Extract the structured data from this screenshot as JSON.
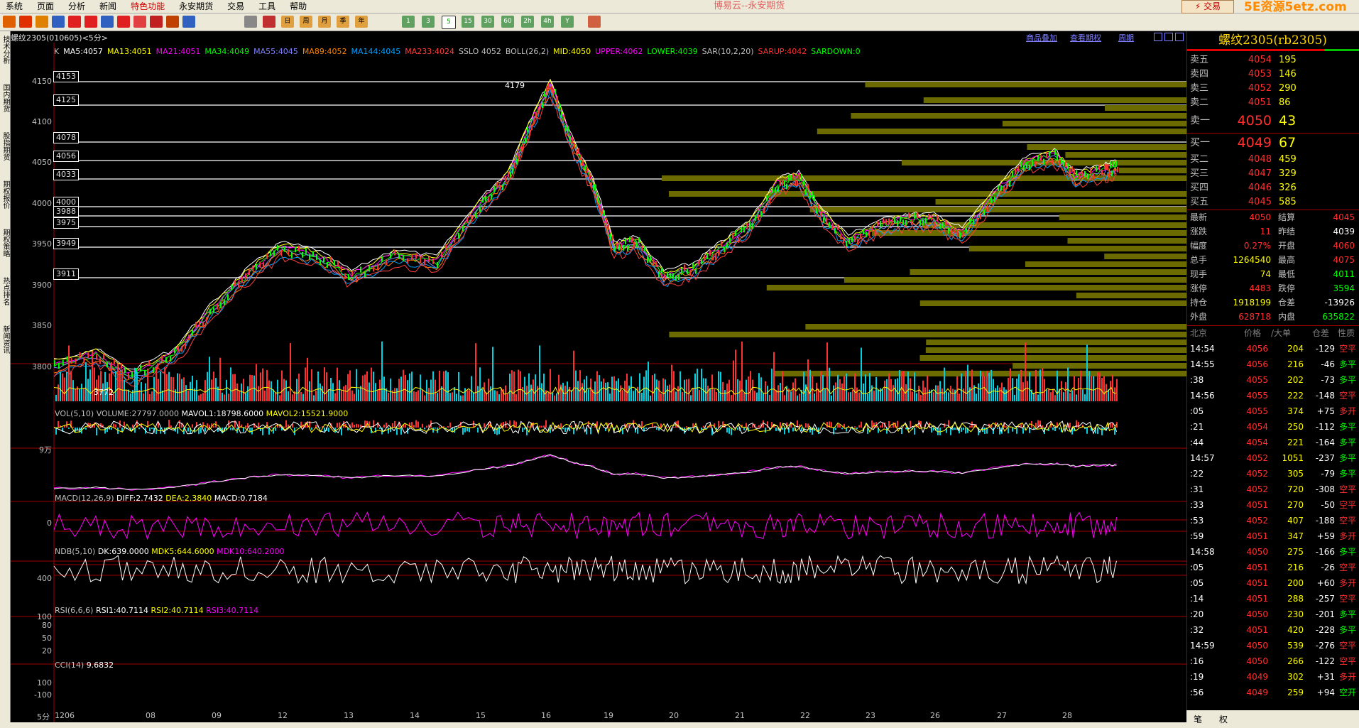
{
  "menu": {
    "items": [
      "系统",
      "页面",
      "分析",
      "新闻",
      "特色功能",
      "永安期货",
      "交易",
      "工具",
      "帮助"
    ],
    "highlight_index": 4
  },
  "app_title": "博易云--永安期货",
  "trade_button": "⚡ 交易",
  "watermark": "5E资源5etz.com",
  "toolbar": {
    "period_buttons": [
      "1",
      "3",
      "5",
      "15",
      "30",
      "60",
      "2h",
      "4h",
      "Y"
    ],
    "selected_period": "5",
    "other_buttons": [
      "日",
      "周",
      "月",
      "季",
      "年"
    ]
  },
  "left_tabs": [
    "技术分析",
    "国内期货",
    "股指期货",
    "期权报价",
    "期权策略",
    "热点排名",
    "新闻资讯"
  ],
  "chart_header": {
    "symbol": "螺纹2305(010605)<5分>",
    "links": [
      "商品叠加",
      "查看期权",
      "周期"
    ]
  },
  "indicator_line": [
    {
      "text": "K",
      "color": "#c0c0c0"
    },
    {
      "text": "MA5:4057",
      "color": "#ffffff"
    },
    {
      "text": "MA13:4051",
      "color": "#ffff00"
    },
    {
      "text": "MA21:4051",
      "color": "#ff00ff"
    },
    {
      "text": "MA34:4049",
      "color": "#00ff00"
    },
    {
      "text": "MA55:4045",
      "color": "#8080ff"
    },
    {
      "text": "MA89:4052",
      "color": "#ff8000"
    },
    {
      "text": "MA144:4045",
      "color": "#00a0ff"
    },
    {
      "text": "MA233:4024",
      "color": "#ff4040"
    },
    {
      "text": "SSLO 4052",
      "color": "#c0c0c0"
    },
    {
      "text": "BOLL(26,2)",
      "color": "#c0c0c0"
    },
    {
      "text": "MID:4050",
      "color": "#ffff00"
    },
    {
      "text": "UPPER:4062",
      "color": "#ff00ff"
    },
    {
      "text": "LOWER:4039",
      "color": "#00ff00"
    },
    {
      "text": "SAR(10,2,20)",
      "color": "#c0c0c0"
    },
    {
      "text": "SARUP:4042",
      "color": "#ff3030"
    },
    {
      "text": "SARDOWN:0",
      "color": "#00ff00"
    }
  ],
  "price_axis": [
    "4150",
    "4100",
    "4050",
    "4000",
    "3950",
    "3900",
    "3850",
    "3800"
  ],
  "level_boxes": [
    "4153",
    "4125",
    "4078",
    "4056",
    "4033",
    "4000",
    "3988",
    "3975",
    "3949",
    "3911"
  ],
  "annotations": {
    "high": "4179",
    "low": "3772"
  },
  "volume": {
    "label": "VOL(5,10) VOLUME:27797.0000",
    "mavol1": "MAVOL1:18798.6000",
    "mavol2": "MAVOL2:15521.9000",
    "axis": "9万"
  },
  "macd": {
    "label": "MACD(12,26,9)",
    "diff": "DIFF:2.7432",
    "dea": "DEA:2.3840",
    "macd": "MACD:0.7184",
    "axis": "0"
  },
  "ndb": {
    "label": "NDB(5,10)",
    "dk": "DK:639.0000",
    "mdk5": "MDK5:644.6000",
    "mdk10": "MDK10:640.2000",
    "axis": "400"
  },
  "rsi": {
    "label": "RSI(6,6,6)",
    "rsi1": "RSI1:40.7114",
    "rsi2": "RSI2:40.7114",
    "rsi3": "RSI3:40.7114",
    "axis": [
      "100",
      "80",
      "50",
      "20"
    ]
  },
  "cci": {
    "label": "CCI(14)",
    "value": "9.6832",
    "axis": [
      "100",
      "-100"
    ]
  },
  "x_axis": [
    "1206",
    "08",
    "09",
    "12",
    "13",
    "14",
    "15",
    "16",
    "19",
    "20",
    "21",
    "22",
    "23",
    "26",
    "27",
    "28"
  ],
  "x_period_label": "5分",
  "quote": {
    "title": "螺纹2305(rb2305)",
    "asks": [
      {
        "name": "卖五",
        "price": "4054",
        "vol": "195"
      },
      {
        "name": "卖四",
        "price": "4053",
        "vol": "146"
      },
      {
        "name": "卖三",
        "price": "4052",
        "vol": "290"
      },
      {
        "name": "卖二",
        "price": "4051",
        "vol": "86"
      },
      {
        "name": "卖一",
        "price": "4050",
        "vol": "43"
      }
    ],
    "bids": [
      {
        "name": "买一",
        "price": "4049",
        "vol": "67"
      },
      {
        "name": "买二",
        "price": "4048",
        "vol": "459"
      },
      {
        "name": "买三",
        "price": "4047",
        "vol": "329"
      },
      {
        "name": "买四",
        "price": "4046",
        "vol": "326"
      },
      {
        "name": "买五",
        "price": "4045",
        "vol": "585"
      }
    ],
    "stats": [
      {
        "l": "最新",
        "v": "4050",
        "vc": "#ff3030",
        "l2": "结算",
        "v2": "4045",
        "v2c": "#ff3030"
      },
      {
        "l": "涨跌",
        "v": "11",
        "vc": "#ff3030",
        "l2": "昨结",
        "v2": "4039",
        "v2c": "#ffffff"
      },
      {
        "l": "幅度",
        "v": "0.27%",
        "vc": "#ff3030",
        "l2": "开盘",
        "v2": "4060",
        "v2c": "#ff3030"
      },
      {
        "l": "总手",
        "v": "1264540",
        "vc": "#ffff00",
        "l2": "最高",
        "v2": "4075",
        "v2c": "#ff3030"
      },
      {
        "l": "现手",
        "v": "74",
        "vc": "#ffff00",
        "l2": "最低",
        "v2": "4011",
        "v2c": "#00ff00"
      },
      {
        "l": "涨停",
        "v": "4483",
        "vc": "#ff3030",
        "l2": "跌停",
        "v2": "3594",
        "v2c": "#00ff00"
      },
      {
        "l": "持仓",
        "v": "1918199",
        "vc": "#ffff00",
        "l2": "仓差",
        "v2": "-13926",
        "v2c": "#ffffff"
      },
      {
        "l": "外盘",
        "v": "628718",
        "vc": "#ff3030",
        "l2": "内盘",
        "v2": "635822",
        "v2c": "#00ff00"
      }
    ],
    "ticks_header": [
      "北京",
      "价格",
      "/大单",
      "仓差",
      "性质"
    ],
    "ticks": [
      {
        "t": "14:54",
        "p": "4056",
        "v": "204",
        "d": "-129",
        "k": "空平",
        "kc": "#ff3030"
      },
      {
        "t": "14:55",
        "p": "4056",
        "v": "216",
        "d": "-46",
        "k": "多平",
        "kc": "#00ff00"
      },
      {
        "t": ":38",
        "p": "4055",
        "v": "202",
        "d": "-73",
        "k": "多平",
        "kc": "#00ff00"
      },
      {
        "t": "14:56",
        "p": "4055",
        "v": "222",
        "d": "-148",
        "k": "空平",
        "kc": "#ff3030"
      },
      {
        "t": ":05",
        "p": "4055",
        "v": "374",
        "d": "+75",
        "k": "多开",
        "kc": "#ff3030"
      },
      {
        "t": ":21",
        "p": "4054",
        "v": "250",
        "d": "-112",
        "k": "多平",
        "kc": "#00ff00"
      },
      {
        "t": ":44",
        "p": "4054",
        "v": "221",
        "d": "-164",
        "k": "多平",
        "kc": "#00ff00"
      },
      {
        "t": "14:57",
        "p": "4052",
        "v": "1051",
        "d": "-237",
        "k": "多平",
        "kc": "#00ff00"
      },
      {
        "t": ":22",
        "p": "4052",
        "v": "305",
        "d": "-79",
        "k": "多平",
        "kc": "#00ff00"
      },
      {
        "t": ":31",
        "p": "4052",
        "v": "720",
        "d": "-308",
        "k": "空平",
        "kc": "#ff3030"
      },
      {
        "t": ":33",
        "p": "4051",
        "v": "270",
        "d": "-50",
        "k": "空平",
        "kc": "#ff3030"
      },
      {
        "t": ":53",
        "p": "4052",
        "v": "407",
        "d": "-188",
        "k": "空平",
        "kc": "#ff3030"
      },
      {
        "t": ":59",
        "p": "4051",
        "v": "347",
        "d": "+59",
        "k": "多开",
        "kc": "#ff3030"
      },
      {
        "t": "14:58",
        "p": "4050",
        "v": "275",
        "d": "-166",
        "k": "多平",
        "kc": "#00ff00"
      },
      {
        "t": ":05",
        "p": "4051",
        "v": "216",
        "d": "-26",
        "k": "空平",
        "kc": "#ff3030"
      },
      {
        "t": ":05",
        "p": "4051",
        "v": "200",
        "d": "+60",
        "k": "多开",
        "kc": "#ff3030"
      },
      {
        "t": ":14",
        "p": "4051",
        "v": "288",
        "d": "-257",
        "k": "空平",
        "kc": "#ff3030"
      },
      {
        "t": ":20",
        "p": "4050",
        "v": "230",
        "d": "-201",
        "k": "多平",
        "kc": "#00ff00"
      },
      {
        "t": ":32",
        "p": "4051",
        "v": "420",
        "d": "-228",
        "k": "多平",
        "kc": "#00ff00"
      },
      {
        "t": "14:59",
        "p": "4050",
        "v": "539",
        "d": "-276",
        "k": "空平",
        "kc": "#ff3030"
      },
      {
        "t": ":16",
        "p": "4050",
        "v": "266",
        "d": "-122",
        "k": "空平",
        "kc": "#ff3030"
      },
      {
        "t": ":19",
        "p": "4049",
        "v": "302",
        "d": "+31",
        "k": "多开",
        "kc": "#ff3030"
      },
      {
        "t": ":56",
        "p": "4049",
        "v": "259",
        "d": "+94",
        "k": "空开",
        "kc": "#00ff00"
      }
    ],
    "bottom_tabs": [
      "笔",
      "权"
    ]
  }
}
